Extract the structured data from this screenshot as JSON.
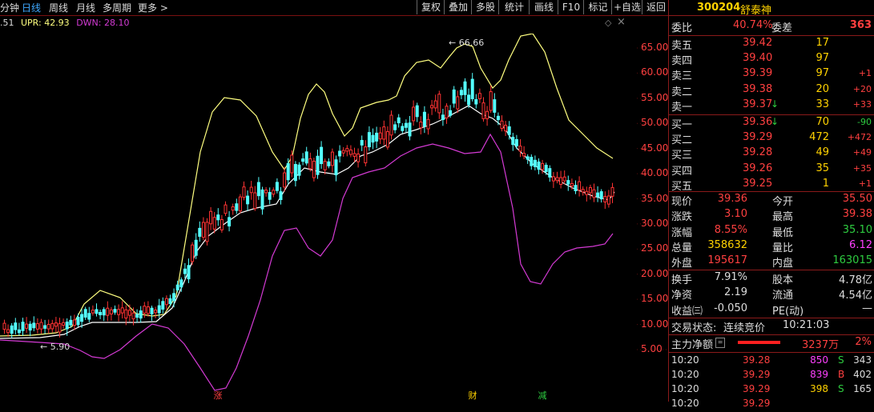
{
  "toolbar": {
    "periods": [
      {
        "label": "分钟"
      },
      {
        "label": "日线"
      },
      {
        "label": "周线"
      },
      {
        "label": "月线"
      },
      {
        "label": "多周期"
      },
      {
        "label": "更多 >"
      }
    ],
    "tools": [
      "复权",
      "叠加",
      "多股",
      "统计",
      "画线",
      "F10",
      "标记",
      "+自选",
      "返回"
    ]
  },
  "indicator": {
    "mid_value": ".51",
    "upr": "UPR: 42.93",
    "dwn": "DWN: 28.10"
  },
  "chart": {
    "high_label": "← 66.66",
    "low_label": "← 5.90",
    "y_ticks": [
      "65.00",
      "60.00",
      "55.00",
      "50.00",
      "45.00",
      "40.00",
      "35.00",
      "30.00",
      "25.00",
      "20.00",
      "15.00",
      "10.00",
      "5.00"
    ],
    "markers": [
      "涨",
      "财",
      "减"
    ],
    "colors": {
      "up": "#ff3333",
      "down": "#54ffff",
      "upper": "#ffff80",
      "middle": "#ffffff",
      "lower": "#d43ad4"
    }
  },
  "panel": {
    "code": "300204",
    "name": "舒泰神",
    "ratio": {
      "label1": "委比",
      "value1": "40.74%",
      "label2": "委差",
      "value2": "363"
    },
    "asks": [
      {
        "label": "卖五",
        "price": "39.42",
        "vol": "17",
        "chg": ""
      },
      {
        "label": "卖四",
        "price": "39.40",
        "vol": "97",
        "chg": ""
      },
      {
        "label": "卖三",
        "price": "39.39",
        "vol": "97",
        "chg": "+1"
      },
      {
        "label": "卖二",
        "price": "39.38",
        "vol": "20",
        "chg": "+20"
      },
      {
        "label": "卖一",
        "price": "39.37",
        "vol": "33",
        "chg": "+33"
      }
    ],
    "bids": [
      {
        "label": "买一",
        "price": "39.36",
        "vol": "70",
        "chg": "-90"
      },
      {
        "label": "买二",
        "price": "39.29",
        "vol": "472",
        "chg": "+472"
      },
      {
        "label": "买三",
        "price": "39.28",
        "vol": "49",
        "chg": "+49"
      },
      {
        "label": "买四",
        "price": "39.26",
        "vol": "35",
        "chg": "+35"
      },
      {
        "label": "买五",
        "price": "39.25",
        "vol": "1",
        "chg": "+1"
      }
    ],
    "quote": [
      {
        "l1": "现价",
        "v1": "39.36",
        "l2": "今开",
        "v2": "35.50"
      },
      {
        "l1": "涨跌",
        "v1": "3.10",
        "l2": "最高",
        "v2": "39.38"
      },
      {
        "l1": "涨幅",
        "v1": "8.55%",
        "l2": "最低",
        "v2": "35.10"
      },
      {
        "l1": "总量",
        "v1": "358632",
        "l2": "量比",
        "v2": "6.12"
      },
      {
        "l1": "外盘",
        "v1": "195617",
        "l2": "内盘",
        "v2": "163015"
      }
    ],
    "stats": [
      {
        "l1": "换手",
        "v1": "7.91%",
        "l2": "股本",
        "v2": "4.78亿"
      },
      {
        "l1": "净资",
        "v1": "2.19",
        "l2": "流通",
        "v2": "4.54亿"
      },
      {
        "l1": "收益㈢",
        "v1": "-0.050",
        "l2": "PE(动)",
        "v2": "—"
      }
    ],
    "status": {
      "label": "交易状态:",
      "value": "连续竞价",
      "time": "10:21:03"
    },
    "flow": {
      "label": "主力净额",
      "amount": "3237万",
      "pct": "2%"
    },
    "ticks": [
      {
        "time": "10:20",
        "price": "39.28",
        "vol": "850",
        "side": "S",
        "n": "343"
      },
      {
        "time": "10:20",
        "price": "39.29",
        "vol": "839",
        "side": "B",
        "n": "402"
      },
      {
        "time": "10:20",
        "price": "39.29",
        "vol": "398",
        "side": "S",
        "n": "165"
      },
      {
        "time": "10:20",
        "price": "39.29",
        "vol": "",
        "side": "",
        "n": ""
      }
    ]
  }
}
